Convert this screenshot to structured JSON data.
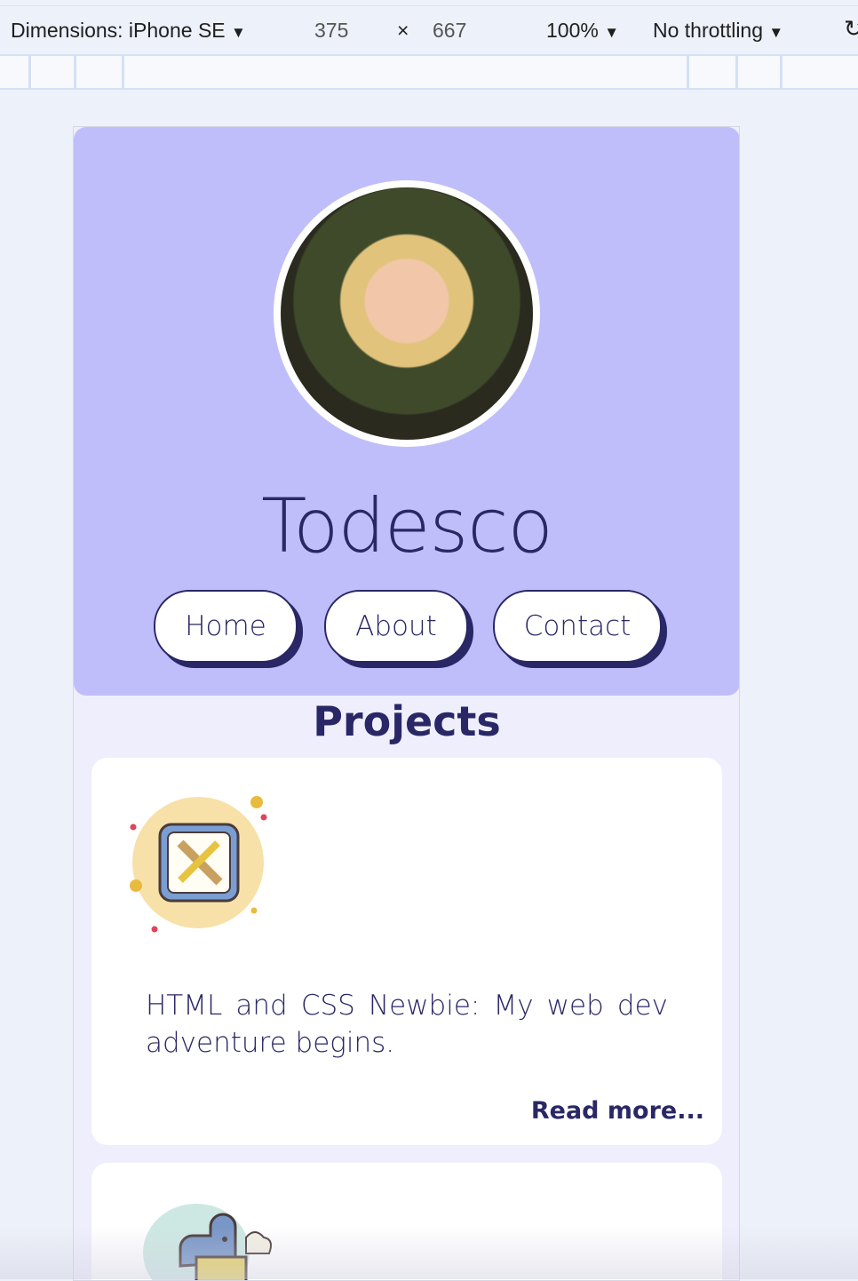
{
  "devtools": {
    "dimensions_label": "Dimensions: iPhone SE",
    "width": "375",
    "times": "×",
    "height": "667",
    "zoom": "100%",
    "throttling": "No throttling"
  },
  "site": {
    "title": "Todesco",
    "nav": [
      {
        "label": "Home"
      },
      {
        "label": "About"
      },
      {
        "label": "Contact"
      }
    ],
    "projects_heading": "Projects",
    "cards": [
      {
        "icon": "pencil-ruler-icon",
        "description": "HTML and CSS Newbie: My web dev adventure begins.",
        "link": "Read more..."
      },
      {
        "icon": "python-icon"
      }
    ]
  },
  "colors": {
    "header_bg": "#c0befa",
    "text": "#2a2766",
    "page_bg": "#efeefc"
  }
}
